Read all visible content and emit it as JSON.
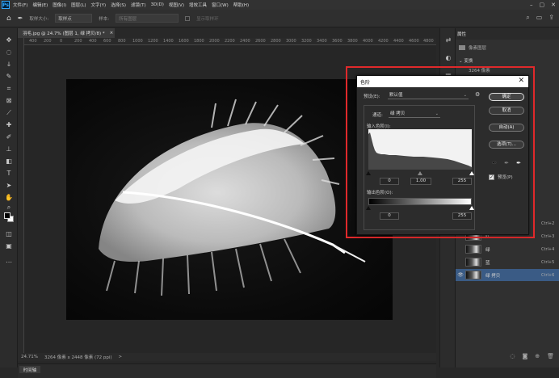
{
  "menu": {
    "logo": "Ps",
    "items": [
      "文件(F)",
      "编辑(E)",
      "图像(I)",
      "图层(L)",
      "文字(Y)",
      "选择(S)",
      "滤镜(T)",
      "3D(D)",
      "视图(V)",
      "增效工具",
      "窗口(W)",
      "帮助(H)"
    ]
  },
  "options": {
    "sample_size_label": "取样大小:",
    "sample_size_value": "取样点",
    "sample_label": "样本:",
    "sample_value": "所有图层",
    "ring_label": "显示取样环"
  },
  "document": {
    "tab_title": "羽毛.jpg @ 24.7% (图层 1, 绿 拷贝/8) *",
    "tab_close": "×"
  },
  "ruler": {
    "ticks": [
      "400",
      "200",
      "0",
      "200",
      "400",
      "600",
      "800",
      "1000",
      "1200",
      "1400",
      "1600",
      "1800",
      "2000",
      "2200",
      "2400",
      "2600",
      "2800",
      "3000",
      "3200",
      "3400",
      "3600",
      "3800",
      "4000",
      "4200",
      "4400",
      "4600",
      "4800"
    ]
  },
  "status": {
    "zoom": "24.71%",
    "size": "3264 像素 x 2448 像素 (72 ppi)",
    "arrow": ">"
  },
  "timeline": {
    "tab": "时间轴"
  },
  "properties": {
    "tab": "属性",
    "row_label": "像素图层",
    "transform_label": "变换",
    "readout": "3264 像素"
  },
  "channels": [
    {
      "name": "",
      "shortcut": "Ctrl+2",
      "eye": false,
      "active": false
    },
    {
      "name": "红",
      "shortcut": "Ctrl+3",
      "eye": false,
      "active": false
    },
    {
      "name": "绿",
      "shortcut": "Ctrl+4",
      "eye": false,
      "active": false
    },
    {
      "name": "蓝",
      "shortcut": "Ctrl+5",
      "eye": false,
      "active": false
    },
    {
      "name": "绿 拷贝",
      "shortcut": "Ctrl+6",
      "eye": true,
      "active": true
    }
  ],
  "levels": {
    "title": "色阶",
    "close": "✕",
    "preset_label": "预设(E):",
    "preset_value": "默认值",
    "channel_label": "通道:",
    "channel_value": "绿 拷贝",
    "input_label": "输入色阶(I):",
    "input_black": "0",
    "input_gamma": "1.00",
    "input_white": "255",
    "output_label": "输出色阶(O):",
    "output_black": "0",
    "output_white": "255",
    "buttons": {
      "ok": "确定",
      "cancel": "取消",
      "auto": "自动(A)",
      "options": "选项(T)..."
    },
    "preview_label": "预览(P)",
    "preview_checked": "✓"
  },
  "colors": {
    "accent_red": "#e0292b",
    "active_row": "#3a5b85",
    "ps_blue": "#31a8ff"
  }
}
